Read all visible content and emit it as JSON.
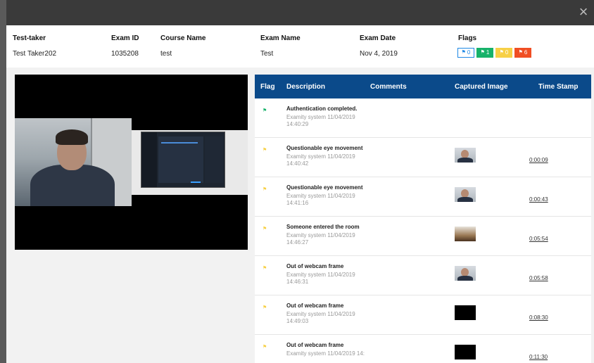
{
  "window": {
    "close_glyph": "×"
  },
  "exam_info": {
    "headers": {
      "test_taker": "Test-taker",
      "exam_id": "Exam ID",
      "course_name": "Course Name",
      "exam_name": "Exam Name",
      "exam_date": "Exam Date",
      "flags": "Flags"
    },
    "values": {
      "test_taker": "Test Taker202",
      "exam_id": "1035208",
      "course_name": "test",
      "exam_name": "Test",
      "exam_date": "Nov 4, 2019"
    },
    "flag_counts": [
      {
        "name": "blue",
        "count": "0",
        "color": "#1e88e5",
        "style": "outline",
        "icon": "flag-icon"
      },
      {
        "name": "green",
        "count": "1",
        "color": "#17b26a",
        "style": "solid",
        "icon": "flag-icon"
      },
      {
        "name": "yellow",
        "count": "0",
        "color": "#f7d046",
        "style": "solid",
        "icon": "flag-icon"
      },
      {
        "name": "red",
        "count": "6",
        "color": "#f04e23",
        "style": "solid",
        "icon": "flag-icon"
      }
    ]
  },
  "table": {
    "columns": {
      "flag": "Flag",
      "description": "Description",
      "comments": "Comments",
      "captured_image": "Captured Image",
      "time_stamp": "Time Stamp"
    },
    "rows": [
      {
        "flag_color": "#17b26a",
        "description": "Authentication completed.",
        "meta": "Examity system   11/04/2019 14:40:29",
        "image": "",
        "time_stamp": ""
      },
      {
        "flag_color": "#f7d046",
        "description": "Questionable eye movement",
        "meta": "Examity system   11/04/2019 14:40:42",
        "image": "person",
        "time_stamp": "0:00:09"
      },
      {
        "flag_color": "#f7d046",
        "description": "Questionable eye movement",
        "meta": "Examity system   11/04/2019 14:41:16",
        "image": "person",
        "time_stamp": "0:00:43"
      },
      {
        "flag_color": "#f7d046",
        "description": "Someone entered the room",
        "meta": "Examity system   11/04/2019 14:46:27",
        "image": "room",
        "time_stamp": "0:05:54"
      },
      {
        "flag_color": "#f7d046",
        "description": "Out of webcam frame",
        "meta": "Examity system   11/04/2019 14:46:31",
        "image": "person",
        "time_stamp": "0:05:58"
      },
      {
        "flag_color": "#f7d046",
        "description": "Out of webcam frame",
        "meta": "Examity system   11/04/2019 14:49:03",
        "image": "black",
        "time_stamp": "0:08:30"
      },
      {
        "flag_color": "#f7d046",
        "description": "Out of webcam frame",
        "meta": "Examity system   11/04/2019 14:",
        "image": "black",
        "time_stamp": "0:11:30"
      }
    ]
  },
  "colors": {
    "header_blue": "#0b4a8a",
    "scroll_accent": "#f1b91f",
    "topbar": "#3a3a3a"
  }
}
